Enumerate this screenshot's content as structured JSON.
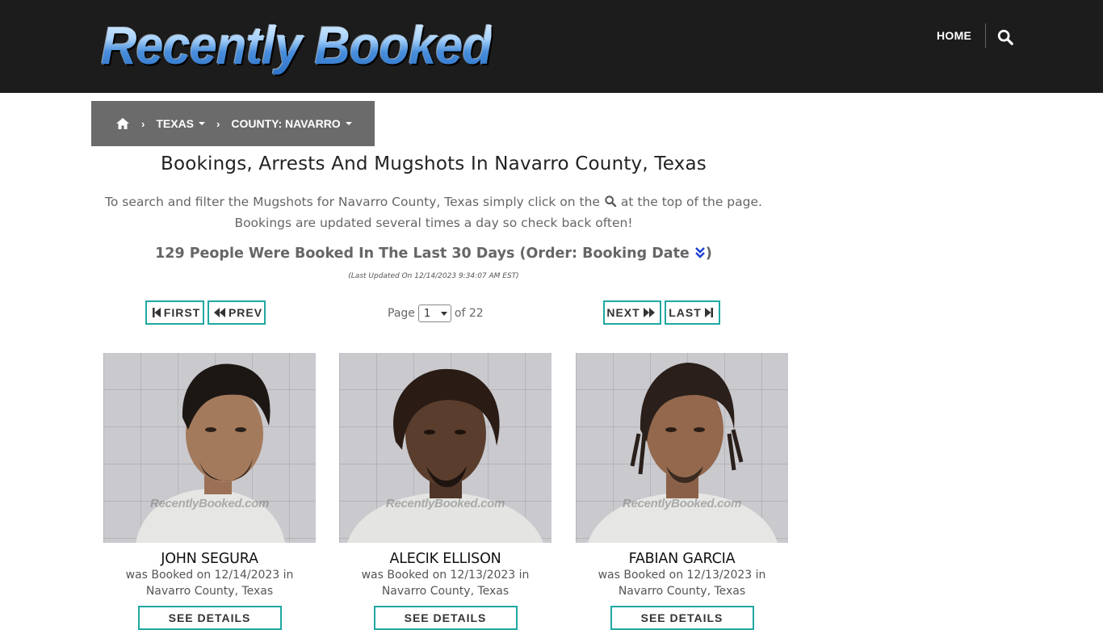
{
  "header": {
    "logo_text": "Recently Booked",
    "nav_home": "HOME",
    "search_icon": "search-icon"
  },
  "breadcrumb": {
    "home_icon": "home-icon",
    "state": "TEXAS",
    "county": "COUNTY: NAVARRO"
  },
  "main": {
    "title": "Bookings, Arrests And Mugshots In Navarro County, Texas",
    "intro_line1_a": "To search and filter the Mugshots for Navarro County, Texas simply click on the",
    "intro_line1_b": "at the top of the page.",
    "intro_line2": "Bookings are updated several times a day so check back often!",
    "count_text": "129 People Were Booked In The Last 30 Days (Order: Booking Date",
    "count_close": ")",
    "updated": "(Last Updated On 12/14/2023 9:34:07 AM EST)"
  },
  "pager": {
    "first": "FIRST",
    "prev": "PREV",
    "next": "NEXT",
    "last": "LAST",
    "page_label": "Page",
    "page_value": "1",
    "of_label": "of 22"
  },
  "cards": [
    {
      "name": "JOHN SEGURA",
      "booked": "was Booked on 12/14/2023 in",
      "location": "Navarro County, Texas",
      "button": "SEE DETAILS",
      "watermark": "RecentlyBooked.com"
    },
    {
      "name": "ALECIK ELLISON",
      "booked": "was Booked on 12/13/2023 in",
      "location": "Navarro County, Texas",
      "button": "SEE DETAILS",
      "watermark": "RecentlyBooked.com"
    },
    {
      "name": "FABIAN GARCIA",
      "booked": "was Booked on 12/13/2023 in",
      "location": "Navarro County, Texas",
      "button": "SEE DETAILS",
      "watermark": "RecentlyBooked.com"
    }
  ],
  "colors": {
    "header_bg": "#1c1c1c",
    "breadcrumb_bg": "#6b6b6b",
    "accent_border": "#20a8a2",
    "order_icon": "#1a3fd0"
  }
}
